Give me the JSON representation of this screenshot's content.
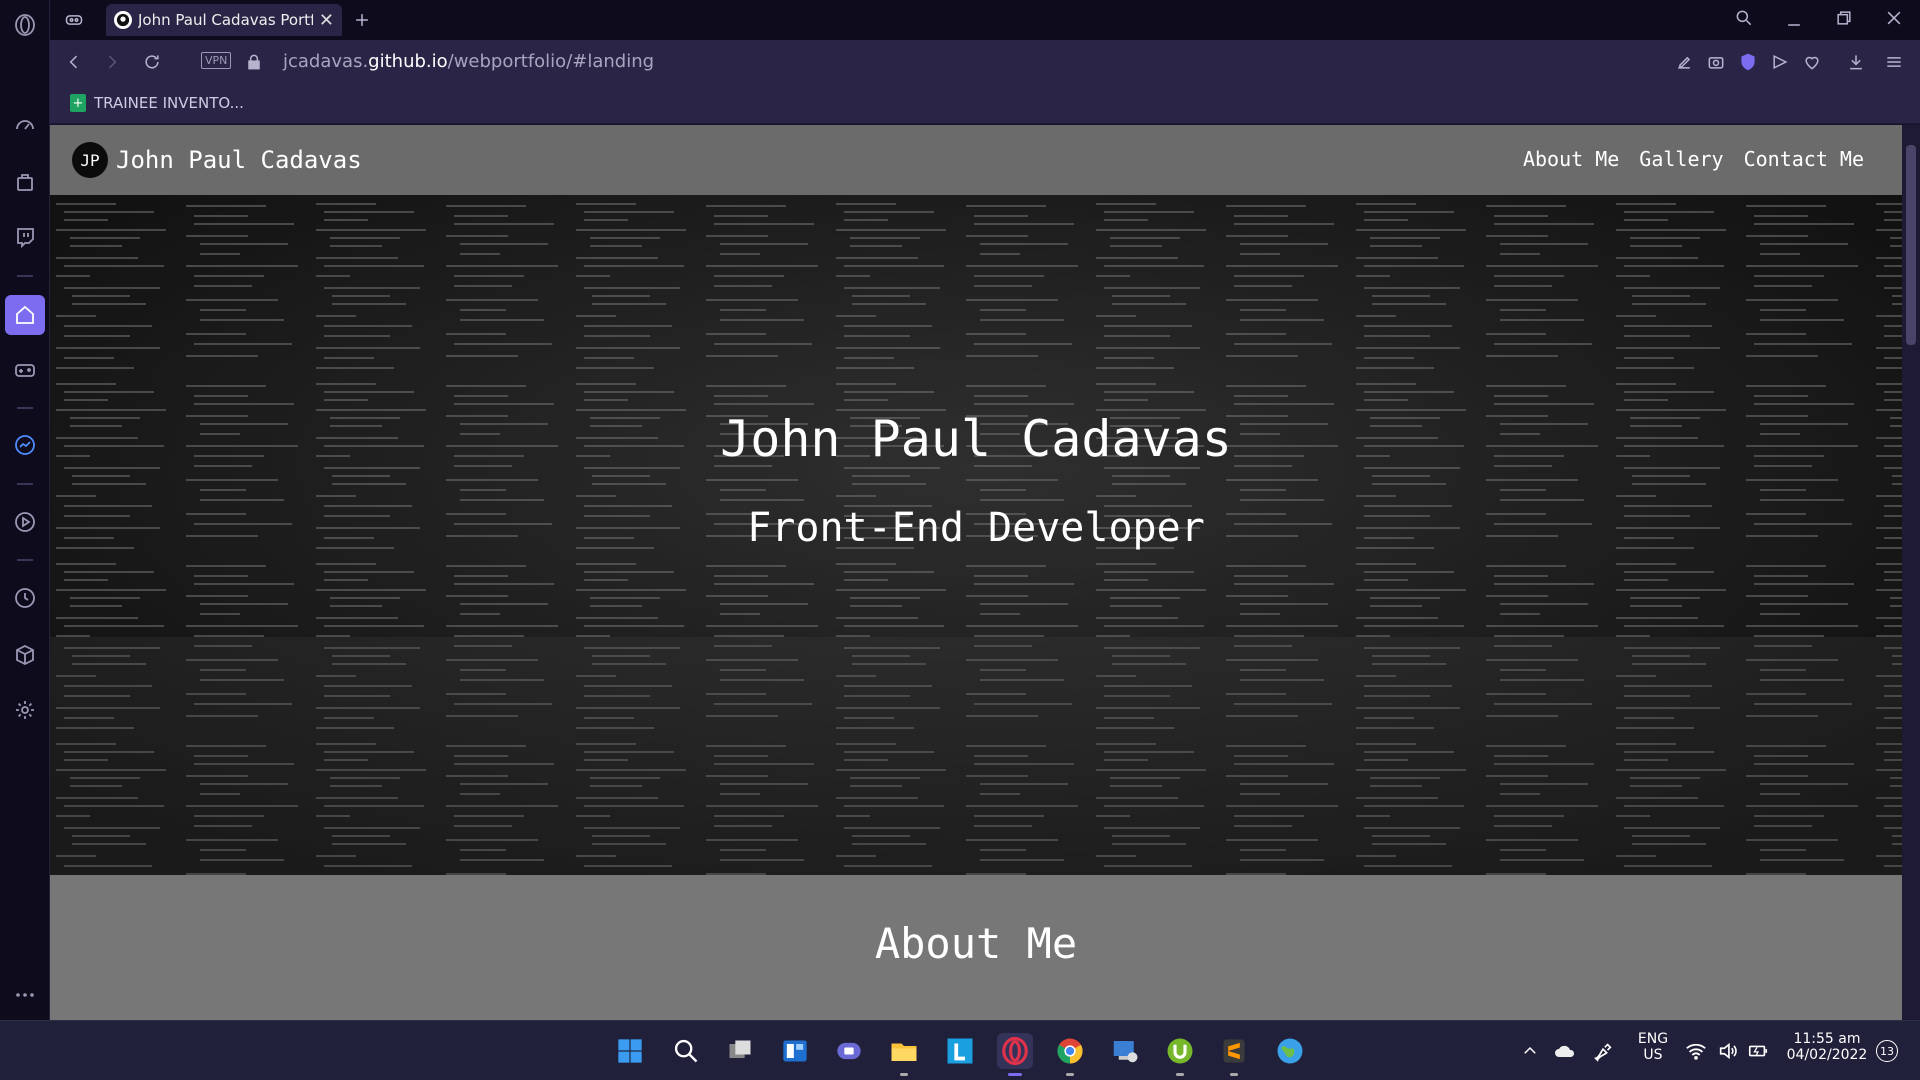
{
  "browser": {
    "tab_title": "John Paul Cadavas Portfolio",
    "url_prefix": "jcadavas.",
    "url_domain": "github.io",
    "url_path": "/webportfolio/#landing",
    "vpn_label": "VPN",
    "bookmark_label": "TRAINEE INVENTO...",
    "accent_color": "#7b6cf0"
  },
  "site": {
    "name": "John Paul Cadavas",
    "logo_glyph": "JP",
    "nav": [
      "About Me",
      "Gallery",
      "Contact Me"
    ],
    "hero_title": "John Paul Cadavas",
    "hero_subtitle": "Front-End Developer",
    "about_title": "About Me"
  },
  "taskbar": {
    "lang_line1": "ENG",
    "lang_line2": "US",
    "time": "11:55 am",
    "date": "04/02/2022",
    "notification_count": "13"
  }
}
